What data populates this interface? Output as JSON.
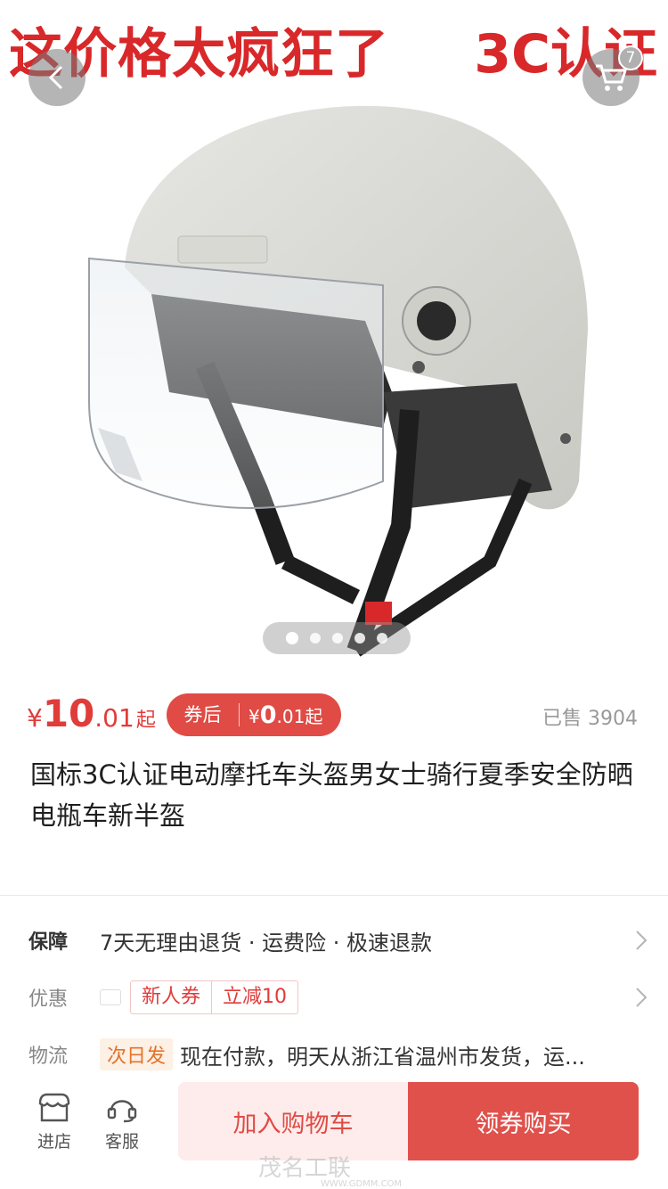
{
  "banner": {
    "left_text": "这价格太疯狂了",
    "right_text": "3C认证"
  },
  "nav": {
    "cart_count": "7"
  },
  "gallery": {
    "total_images": 5,
    "active_index": 0
  },
  "price": {
    "currency": "¥",
    "integer": "10",
    "decimal": ".01",
    "suffix": "起"
  },
  "coupon": {
    "tag": "券后",
    "currency": "¥",
    "integer": "0",
    "decimal": ".01",
    "suffix": "起"
  },
  "sold": "已售 3904",
  "title": "国标3C认证电动摩托车头盔男女士骑行夏季安全防晒电瓶车新半盔",
  "services": {
    "guarantee_label": "保障",
    "guarantee_text": "7天无理由退货 · 运费险 · 极速退款",
    "promo_label": "优惠",
    "promo_tags": [
      "新人券",
      "立减10"
    ],
    "shipping_label": "物流",
    "shipping_tag": "次日发",
    "shipping_text": "现在付款，明天从浙江省温州市发货，运..."
  },
  "bottom": {
    "store_label": "进店",
    "service_label": "客服",
    "add_cart_label": "加入购物车",
    "buy_label": "领券购买"
  },
  "watermark": {
    "text": "茂名工联",
    "url": "WWW.GDMM.COM"
  },
  "colors": {
    "accent": "#e03c3a",
    "buy_button": "#e0514c",
    "cart_button_bg": "#fdeceb",
    "ship_tag": "#e3732b"
  }
}
